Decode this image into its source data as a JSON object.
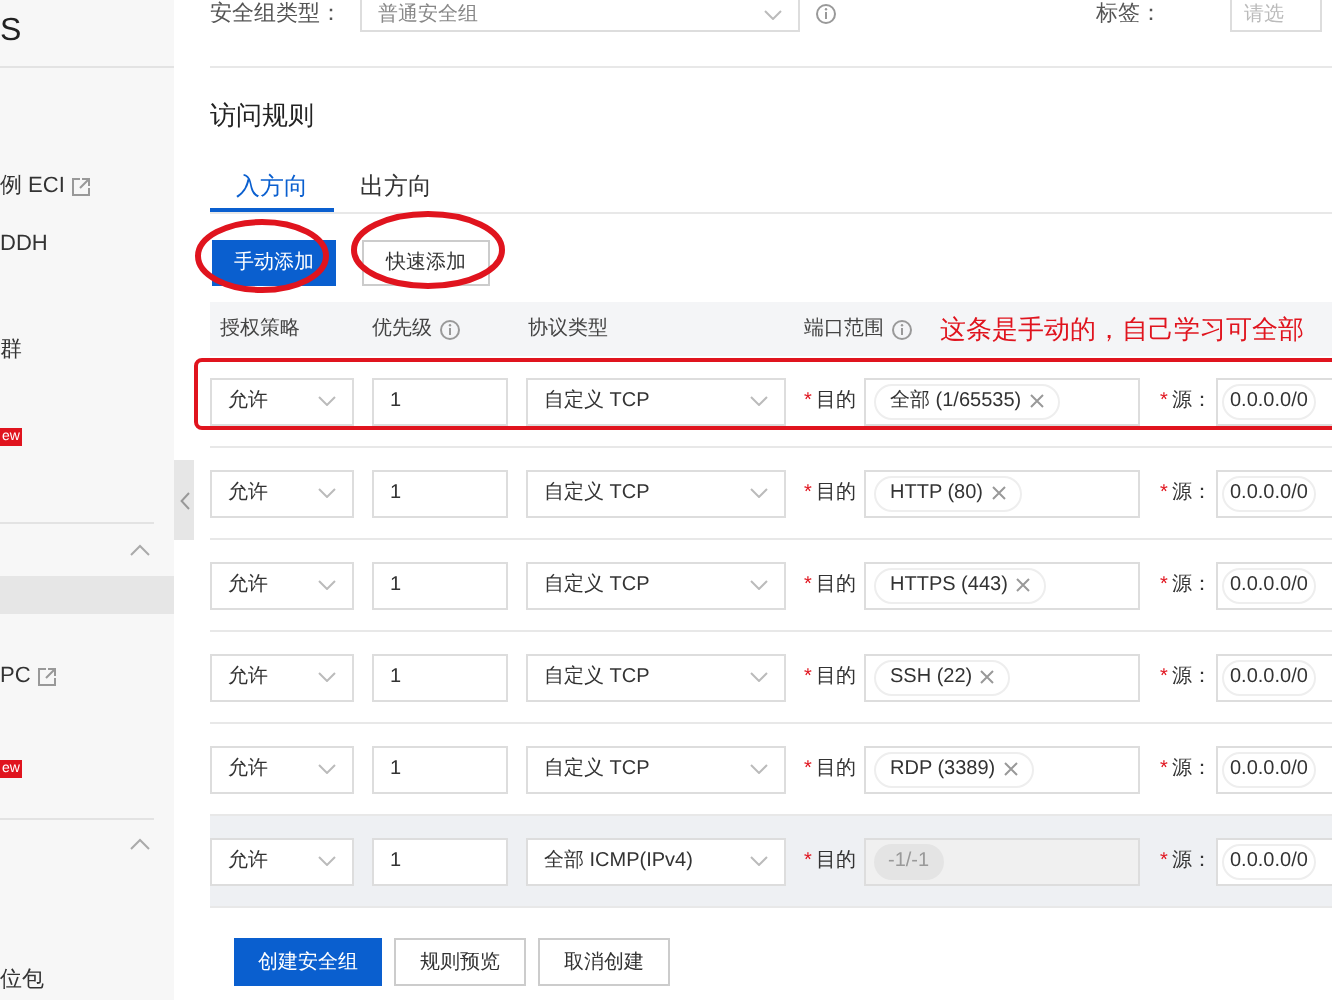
{
  "sidebar": {
    "items": [
      {
        "kind": "title",
        "label": "S",
        "selected": false
      },
      {
        "kind": "link",
        "label": "例 ECI",
        "external": true,
        "selected": false
      },
      {
        "kind": "link",
        "label": "DDH",
        "external": false,
        "selected": false
      },
      {
        "kind": "link",
        "label": "群",
        "external": false,
        "selected": false
      },
      {
        "kind": "badge",
        "label": "ew"
      },
      {
        "kind": "group",
        "expanded": true
      },
      {
        "kind": "link",
        "external": false,
        "selected": true
      },
      {
        "kind": "link",
        "label": "PC",
        "external": true,
        "selected": false
      },
      {
        "kind": "badge",
        "label": "ew"
      },
      {
        "kind": "group",
        "expanded": true
      },
      {
        "kind": "link",
        "label": "位包",
        "external": false,
        "selected": false
      }
    ]
  },
  "form": {
    "type_label": "安全组类型：",
    "type_value": "普通安全组",
    "tag_label": "标签：",
    "tag_placeholder": "请选"
  },
  "section_title": "访问规则",
  "tabs": [
    {
      "label": "入方向",
      "selected": true
    },
    {
      "label": "出方向",
      "selected": false
    }
  ],
  "add_buttons": [
    {
      "label": "手动添加",
      "primary": true
    },
    {
      "label": "快速添加",
      "primary": false
    }
  ],
  "columns": [
    {
      "label": "授权策略",
      "info": false
    },
    {
      "label": "优先级",
      "info": true
    },
    {
      "label": "协议类型",
      "info": false
    },
    {
      "label": "端口范围",
      "info": true
    }
  ],
  "annotation": "这条是手动的，自己学习可全部",
  "rules": [
    {
      "policy": "允许",
      "priority": "1",
      "protocol": "自定义 TCP",
      "dest_mark": "*",
      "dest_label": "目的",
      "dest": "全部 (1/65535)",
      "dest_disabled": false,
      "source_mark": "*",
      "source_label": "源：",
      "source": "0.0.0.0/0",
      "hovered": false
    },
    {
      "policy": "允许",
      "priority": "1",
      "protocol": "自定义 TCP",
      "dest_mark": "*",
      "dest_label": "目的",
      "dest": "HTTP (80)",
      "dest_disabled": false,
      "source_mark": "*",
      "source_label": "源：",
      "source": "0.0.0.0/0",
      "hovered": false
    },
    {
      "policy": "允许",
      "priority": "1",
      "protocol": "自定义 TCP",
      "dest_mark": "*",
      "dest_label": "目的",
      "dest": "HTTPS (443)",
      "dest_disabled": false,
      "source_mark": "*",
      "source_label": "源：",
      "source": "0.0.0.0/0",
      "hovered": false
    },
    {
      "policy": "允许",
      "priority": "1",
      "protocol": "自定义 TCP",
      "dest_mark": "*",
      "dest_label": "目的",
      "dest": "SSH (22)",
      "dest_disabled": false,
      "source_mark": "*",
      "source_label": "源：",
      "source": "0.0.0.0/0",
      "hovered": false
    },
    {
      "policy": "允许",
      "priority": "1",
      "protocol": "自定义 TCP",
      "dest_mark": "*",
      "dest_label": "目的",
      "dest": "RDP (3389)",
      "dest_disabled": false,
      "source_mark": "*",
      "source_label": "源：",
      "source": "0.0.0.0/0",
      "hovered": false
    },
    {
      "policy": "允许",
      "priority": "1",
      "protocol": "全部 ICMP(IPv4)",
      "dest_mark": "*",
      "dest_label": "目的",
      "dest": "-1/-1",
      "dest_disabled": true,
      "source_mark": "*",
      "source_label": "源：",
      "source": "0.0.0.0/0",
      "hovered": true
    }
  ],
  "footer_buttons": [
    {
      "label": "创建安全组",
      "primary": true
    },
    {
      "label": "规则预览",
      "primary": false
    },
    {
      "label": "取消创建",
      "primary": false
    }
  ]
}
